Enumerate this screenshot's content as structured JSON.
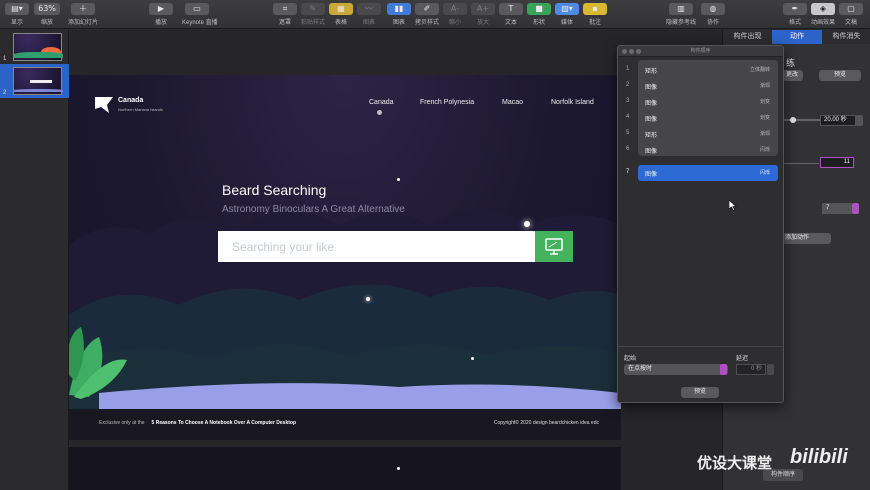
{
  "toolbar": {
    "view": {
      "icon": "view-icon",
      "label": "显示"
    },
    "zoom": {
      "value": "63%",
      "label": "缩放"
    },
    "add_slide": {
      "label": "添加幻灯片"
    },
    "play": {
      "label": "播放"
    },
    "keynote_live": {
      "label": "Keynote 直播"
    },
    "items": [
      {
        "label": "遮罩",
        "icon": "mask-icon",
        "enabled": true
      },
      {
        "label": "粘贴样式",
        "icon": "paste-style-icon",
        "enabled": false
      },
      {
        "label": "表格",
        "icon": "table-icon",
        "enabled": true
      },
      {
        "label": "图表",
        "icon": "chart-icon",
        "enabled": false
      },
      {
        "label": "图表",
        "icon": "chart-icon",
        "enabled": true
      },
      {
        "label": "拷贝样式",
        "icon": "copy-style-icon",
        "enabled": true
      },
      {
        "label": "缩小",
        "icon": "shrink-text-icon",
        "enabled": false
      },
      {
        "label": "放大",
        "icon": "grow-text-icon",
        "enabled": false
      },
      {
        "label": "文本",
        "icon": "text-icon",
        "enabled": true
      },
      {
        "label": "形状",
        "icon": "shape-icon",
        "enabled": true
      },
      {
        "label": "媒体",
        "icon": "media-icon",
        "enabled": true
      },
      {
        "label": "批注",
        "icon": "comment-icon",
        "enabled": true
      }
    ],
    "right": [
      {
        "label": "隐藏参考线",
        "icon": "guides-icon"
      },
      {
        "label": "协作",
        "icon": "collaborate-icon"
      },
      {
        "label": "格式",
        "icon": "format-icon"
      },
      {
        "label": "动画效果",
        "icon": "animate-icon"
      },
      {
        "label": "文稿",
        "icon": "document-icon"
      }
    ]
  },
  "navigator": {
    "slides": [
      {
        "number": "1"
      },
      {
        "number": "2"
      }
    ]
  },
  "slide": {
    "brand": "Canada",
    "brand_sub": "Northern Mariana Islands",
    "menu": [
      "Canada",
      "French Polynesia",
      "Macao",
      "Norfolk Island"
    ],
    "headline": "Beard Searching",
    "subline": "Astronomy Binoculars A Great Alternative",
    "search_placeholder": "Searching your like",
    "footer_prefix": "Exclusive only at the",
    "footer_link": "5 Reasons To Choose A Notebook Over A Computer Desktop",
    "copyright": "Copyright©  2020 design beardchicken idea edc"
  },
  "inspector": {
    "tabs": [
      "构件出现",
      "动作",
      "构件消失"
    ],
    "active_tab": 1,
    "title_partial": "练",
    "change_button": "更改",
    "preview_button": "预览",
    "duration": "20.00 秒",
    "number_value": "11",
    "order_value": "7",
    "add_action": "添加动作"
  },
  "build_order": {
    "title": "构件顺序",
    "rows": [
      {
        "num": "1",
        "name": "矩形",
        "effect": "立体翻转"
      },
      {
        "num": "2",
        "name": "图像",
        "effect": "渐现"
      },
      {
        "num": "3",
        "name": "图像",
        "effect": "划变"
      },
      {
        "num": "4",
        "name": "图像",
        "effect": "划变"
      },
      {
        "num": "5",
        "name": "矩形",
        "effect": "渐现"
      },
      {
        "num": "6",
        "name": "图像",
        "effect": "闪烁"
      }
    ],
    "selected_row": {
      "num": "7",
      "name": "图像",
      "effect": "闪烁"
    },
    "start_label": "起始",
    "start_value": "在点按时",
    "delay_label": "延迟",
    "delay_value": "0 秒",
    "preview": "预览"
  },
  "watermark": "优设大课堂",
  "watermark_logo": "bilibili",
  "bottom_button": "构件顺序",
  "colors": {
    "accent": "#2d63c8",
    "search_button": "#45b35d",
    "highlight": "#b14fc5"
  }
}
